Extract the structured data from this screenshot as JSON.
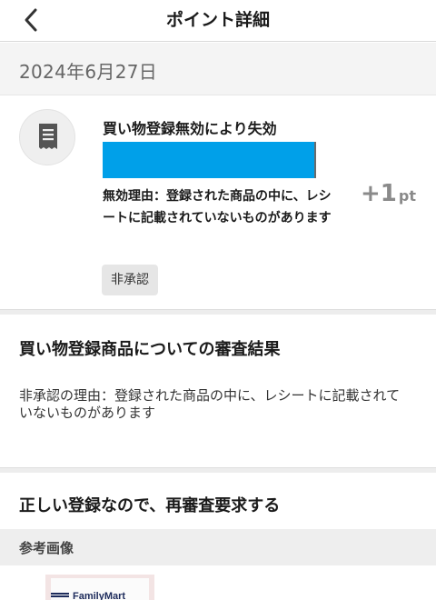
{
  "header": {
    "title": "ポイント詳細",
    "back_icon": "chevron-left-icon"
  },
  "date": "2024年6月27日",
  "entry": {
    "icon": "receipt-icon",
    "title": "買い物登録無効により失効",
    "reason": "無効理由：登録された商品の中に、レシートに記載されていないものがあります",
    "points_value": "+1",
    "points_unit": "pt",
    "status_badge": "非承認",
    "redaction_color": "#00a0e9"
  },
  "review": {
    "heading": "買い物登録商品についての審査結果",
    "text": "非承認の理由：登録された商品の中に、レシートに記載されていないものがあります"
  },
  "rerequest": {
    "label": "正しい登録なので、再審査要求する"
  },
  "reference": {
    "label": "参考画像",
    "thumbnail_text": "FamilyMart"
  }
}
